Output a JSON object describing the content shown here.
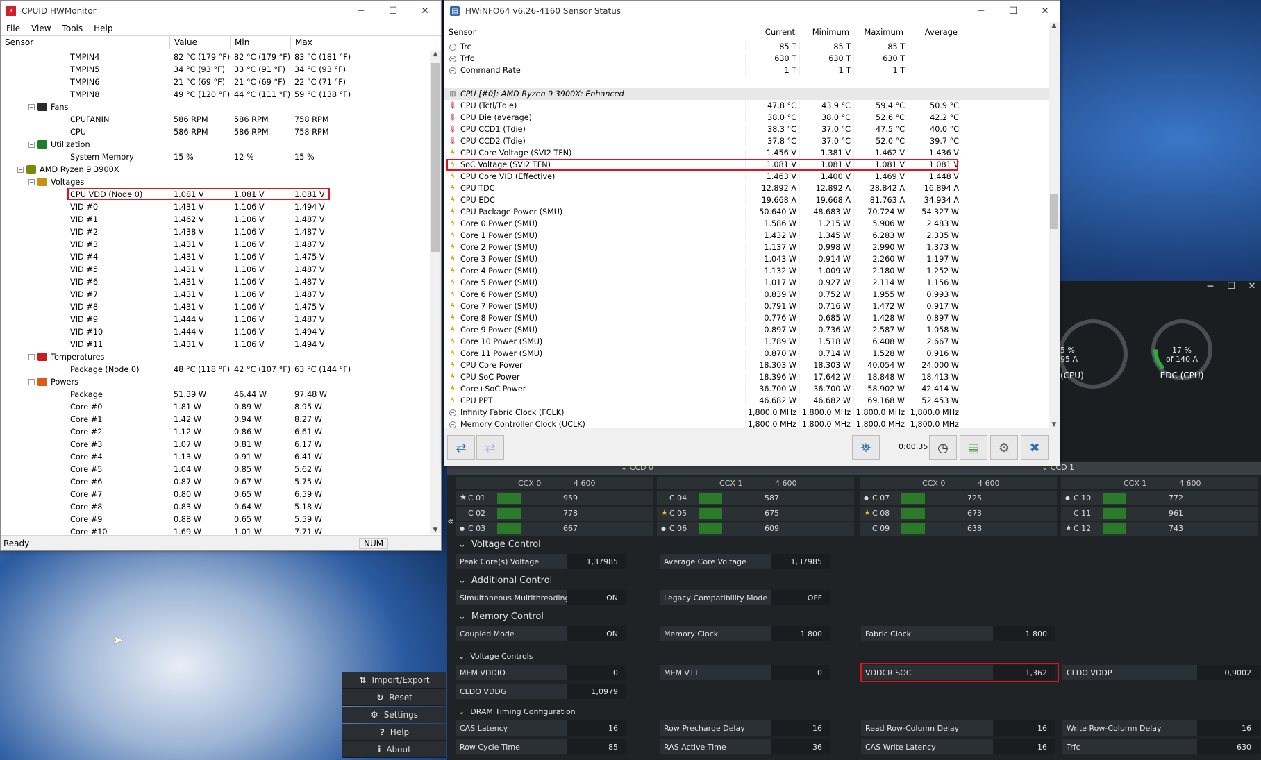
{
  "hwm": {
    "title": "CPUID HWMonitor",
    "menu": [
      "File",
      "View",
      "Tools",
      "Help"
    ],
    "cols": [
      "Sensor",
      "Value",
      "Min",
      "Max"
    ],
    "rows": [
      {
        "i": 4,
        "n": "TMPIN4",
        "v": "82 °C  (179 °F)",
        "mi": "82 °C  (179 °F)",
        "ma": "83 °C  (181 °F)"
      },
      {
        "i": 4,
        "n": "TMPIN5",
        "v": "34 °C  (93 °F)",
        "mi": "33 °C  (91 °F)",
        "ma": "34 °C  (93 °F)"
      },
      {
        "i": 4,
        "n": "TMPIN6",
        "v": "21 °C  (69 °F)",
        "mi": "21 °C  (69 °F)",
        "ma": "22 °C  (71 °F)"
      },
      {
        "i": 4,
        "n": "TMPIN8",
        "v": "49 °C  (120 °F)",
        "mi": "44 °C  (111 °F)",
        "ma": "59 °C  (138 °F)"
      },
      {
        "i": 2,
        "g": "fan",
        "n": "Fans"
      },
      {
        "i": 4,
        "n": "CPUFANIN",
        "v": "586 RPM",
        "mi": "586 RPM",
        "ma": "758 RPM"
      },
      {
        "i": 4,
        "n": "CPU",
        "v": "586 RPM",
        "mi": "586 RPM",
        "ma": "758 RPM"
      },
      {
        "i": 2,
        "g": "util",
        "n": "Utilization"
      },
      {
        "i": 4,
        "n": "System Memory",
        "v": "15 %",
        "mi": "12 %",
        "ma": "15 %"
      },
      {
        "i": 1,
        "g": "chip",
        "n": "AMD Ryzen 9 3900X"
      },
      {
        "i": 2,
        "g": "volt",
        "n": "Voltages"
      },
      {
        "i": 4,
        "n": "CPU VDD (Node 0)",
        "v": "1.081 V",
        "mi": "1.081 V",
        "ma": "1.081 V",
        "hl": true
      },
      {
        "i": 4,
        "n": "VID #0",
        "v": "1.431 V",
        "mi": "1.106 V",
        "ma": "1.494 V"
      },
      {
        "i": 4,
        "n": "VID #1",
        "v": "1.462 V",
        "mi": "1.106 V",
        "ma": "1.487 V"
      },
      {
        "i": 4,
        "n": "VID #2",
        "v": "1.438 V",
        "mi": "1.106 V",
        "ma": "1.487 V"
      },
      {
        "i": 4,
        "n": "VID #3",
        "v": "1.431 V",
        "mi": "1.106 V",
        "ma": "1.487 V"
      },
      {
        "i": 4,
        "n": "VID #4",
        "v": "1.431 V",
        "mi": "1.106 V",
        "ma": "1.475 V"
      },
      {
        "i": 4,
        "n": "VID #5",
        "v": "1.431 V",
        "mi": "1.106 V",
        "ma": "1.487 V"
      },
      {
        "i": 4,
        "n": "VID #6",
        "v": "1.431 V",
        "mi": "1.106 V",
        "ma": "1.487 V"
      },
      {
        "i": 4,
        "n": "VID #7",
        "v": "1.431 V",
        "mi": "1.106 V",
        "ma": "1.487 V"
      },
      {
        "i": 4,
        "n": "VID #8",
        "v": "1.431 V",
        "mi": "1.106 V",
        "ma": "1.475 V"
      },
      {
        "i": 4,
        "n": "VID #9",
        "v": "1.444 V",
        "mi": "1.106 V",
        "ma": "1.487 V"
      },
      {
        "i": 4,
        "n": "VID #10",
        "v": "1.444 V",
        "mi": "1.106 V",
        "ma": "1.494 V"
      },
      {
        "i": 4,
        "n": "VID #11",
        "v": "1.431 V",
        "mi": "1.106 V",
        "ma": "1.494 V"
      },
      {
        "i": 2,
        "g": "temp",
        "n": "Temperatures"
      },
      {
        "i": 4,
        "n": "Package (Node 0)",
        "v": "48 °C  (118 °F)",
        "mi": "42 °C  (107 °F)",
        "ma": "63 °C  (144 °F)"
      },
      {
        "i": 2,
        "g": "pow",
        "n": "Powers"
      },
      {
        "i": 4,
        "n": "Package",
        "v": "51.39 W",
        "mi": "46.44 W",
        "ma": "97.48 W"
      },
      {
        "i": 4,
        "n": "Core #0",
        "v": "1.81 W",
        "mi": "0.89 W",
        "ma": "8.95 W"
      },
      {
        "i": 4,
        "n": "Core #1",
        "v": "1.42 W",
        "mi": "0.94 W",
        "ma": "8.27 W"
      },
      {
        "i": 4,
        "n": "Core #2",
        "v": "1.12 W",
        "mi": "0.86 W",
        "ma": "6.61 W"
      },
      {
        "i": 4,
        "n": "Core #3",
        "v": "1.07 W",
        "mi": "0.81 W",
        "ma": "6.17 W"
      },
      {
        "i": 4,
        "n": "Core #4",
        "v": "1.13 W",
        "mi": "0.91 W",
        "ma": "6.41 W"
      },
      {
        "i": 4,
        "n": "Core #5",
        "v": "1.04 W",
        "mi": "0.85 W",
        "ma": "5.62 W"
      },
      {
        "i": 4,
        "n": "Core #6",
        "v": "0.87 W",
        "mi": "0.67 W",
        "ma": "5.75 W"
      },
      {
        "i": 4,
        "n": "Core #7",
        "v": "0.80 W",
        "mi": "0.65 W",
        "ma": "6.59 W"
      },
      {
        "i": 4,
        "n": "Core #8",
        "v": "0.83 W",
        "mi": "0.64 W",
        "ma": "5.18 W"
      },
      {
        "i": 4,
        "n": "Core #9",
        "v": "0.88 W",
        "mi": "0.65 W",
        "ma": "5.59 W"
      },
      {
        "i": 4,
        "n": "Core #10",
        "v": "1.69 W",
        "mi": "1.01 W",
        "ma": "7.71 W"
      }
    ],
    "status": "Ready",
    "num": "NUM"
  },
  "hwi": {
    "title": "HWiNFO64 v6.26-4160 Sensor Status",
    "cols": [
      "Sensor",
      "Current",
      "Minimum",
      "Maximum",
      "Average"
    ],
    "rows": [
      {
        "ic": "clk",
        "n": "Trc",
        "c": "85 T",
        "mi": "85 T",
        "ma": "85 T",
        "a": ""
      },
      {
        "ic": "clk",
        "n": "Trfc",
        "c": "630 T",
        "mi": "630 T",
        "ma": "630 T",
        "a": ""
      },
      {
        "ic": "clk",
        "n": "Command Rate",
        "c": "1 T",
        "mi": "1 T",
        "ma": "1 T",
        "a": ""
      },
      {
        "ic": "",
        "n": "",
        "c": "",
        "mi": "",
        "ma": "",
        "a": ""
      },
      {
        "ic": "grp",
        "n": "CPU [#0]: AMD Ryzen 9 3900X: Enhanced",
        "c": "",
        "mi": "",
        "ma": "",
        "a": "",
        "grp": true
      },
      {
        "ic": "temp",
        "n": "CPU (Tctl/Tdie)",
        "c": "47.8 °C",
        "mi": "43.9 °C",
        "ma": "59.4 °C",
        "a": "50.9 °C"
      },
      {
        "ic": "temp",
        "n": "CPU Die (average)",
        "c": "38.0 °C",
        "mi": "38.0 °C",
        "ma": "52.6 °C",
        "a": "42.2 °C"
      },
      {
        "ic": "temp",
        "n": "CPU CCD1 (Tdie)",
        "c": "38.3 °C",
        "mi": "37.0 °C",
        "ma": "47.5 °C",
        "a": "40.0 °C"
      },
      {
        "ic": "temp",
        "n": "CPU CCD2 (Tdie)",
        "c": "37.8 °C",
        "mi": "37.0 °C",
        "ma": "52.0 °C",
        "a": "39.7 °C"
      },
      {
        "ic": "bolt",
        "n": "CPU Core Voltage (SVI2 TFN)",
        "c": "1.456 V",
        "mi": "1.381 V",
        "ma": "1.462 V",
        "a": "1.436 V"
      },
      {
        "ic": "bolt",
        "n": "SoC Voltage (SVI2 TFN)",
        "c": "1.081 V",
        "mi": "1.081 V",
        "ma": "1.081 V",
        "a": "1.081 V",
        "hl": true
      },
      {
        "ic": "bolt",
        "n": "CPU Core VID (Effective)",
        "c": "1.463 V",
        "mi": "1.400 V",
        "ma": "1.469 V",
        "a": "1.448 V"
      },
      {
        "ic": "bolt",
        "n": "CPU TDC",
        "c": "12.892 A",
        "mi": "12.892 A",
        "ma": "28.842 A",
        "a": "16.894 A"
      },
      {
        "ic": "bolt",
        "n": "CPU EDC",
        "c": "19.668 A",
        "mi": "19.668 A",
        "ma": "81.763 A",
        "a": "34.934 A"
      },
      {
        "ic": "bolt",
        "n": "CPU Package Power (SMU)",
        "c": "50.640 W",
        "mi": "48.683 W",
        "ma": "70.724 W",
        "a": "54.327 W"
      },
      {
        "ic": "bolt",
        "n": "Core 0 Power (SMU)",
        "c": "1.586 W",
        "mi": "1.215 W",
        "ma": "5.906 W",
        "a": "2.483 W"
      },
      {
        "ic": "bolt",
        "n": "Core 1 Power (SMU)",
        "c": "1.432 W",
        "mi": "1.345 W",
        "ma": "6.283 W",
        "a": "2.335 W"
      },
      {
        "ic": "bolt",
        "n": "Core 2 Power (SMU)",
        "c": "1.137 W",
        "mi": "0.998 W",
        "ma": "2.990 W",
        "a": "1.373 W"
      },
      {
        "ic": "bolt",
        "n": "Core 3 Power (SMU)",
        "c": "1.043 W",
        "mi": "0.914 W",
        "ma": "2.260 W",
        "a": "1.197 W"
      },
      {
        "ic": "bolt",
        "n": "Core 4 Power (SMU)",
        "c": "1.132 W",
        "mi": "1.009 W",
        "ma": "2.180 W",
        "a": "1.252 W"
      },
      {
        "ic": "bolt",
        "n": "Core 5 Power (SMU)",
        "c": "1.017 W",
        "mi": "0.927 W",
        "ma": "2.114 W",
        "a": "1.156 W"
      },
      {
        "ic": "bolt",
        "n": "Core 6 Power (SMU)",
        "c": "0.839 W",
        "mi": "0.752 W",
        "ma": "1.955 W",
        "a": "0.993 W"
      },
      {
        "ic": "bolt",
        "n": "Core 7 Power (SMU)",
        "c": "0.791 W",
        "mi": "0.716 W",
        "ma": "1.472 W",
        "a": "0.917 W"
      },
      {
        "ic": "bolt",
        "n": "Core 8 Power (SMU)",
        "c": "0.776 W",
        "mi": "0.685 W",
        "ma": "1.428 W",
        "a": "0.897 W"
      },
      {
        "ic": "bolt",
        "n": "Core 9 Power (SMU)",
        "c": "0.897 W",
        "mi": "0.736 W",
        "ma": "2.587 W",
        "a": "1.058 W"
      },
      {
        "ic": "bolt",
        "n": "Core 10 Power (SMU)",
        "c": "1.789 W",
        "mi": "1.518 W",
        "ma": "6.408 W",
        "a": "2.667 W"
      },
      {
        "ic": "bolt",
        "n": "Core 11 Power (SMU)",
        "c": "0.870 W",
        "mi": "0.714 W",
        "ma": "1.528 W",
        "a": "0.916 W"
      },
      {
        "ic": "bolt",
        "n": "CPU Core Power",
        "c": "18.303 W",
        "mi": "18.303 W",
        "ma": "40.054 W",
        "a": "24.000 W"
      },
      {
        "ic": "bolt",
        "n": "CPU SoC Power",
        "c": "18.396 W",
        "mi": "17.642 W",
        "ma": "18.848 W",
        "a": "18.413 W"
      },
      {
        "ic": "bolt",
        "n": "Core+SoC Power",
        "c": "36.700 W",
        "mi": "36.700 W",
        "ma": "58.902 W",
        "a": "42.414 W"
      },
      {
        "ic": "bolt",
        "n": "CPU PPT",
        "c": "46.682 W",
        "mi": "46.682 W",
        "ma": "69.168 W",
        "a": "52.453 W"
      },
      {
        "ic": "clk",
        "n": "Infinity Fabric Clock (FCLK)",
        "c": "1,800.0 MHz",
        "mi": "1,800.0 MHz",
        "ma": "1,800.0 MHz",
        "a": "1,800.0 MHz"
      },
      {
        "ic": "clk",
        "n": "Memory Controller Clock (UCLK)",
        "c": "1,800.0 MHz",
        "mi": "1,800.0 MHz",
        "ma": "1,800.0 MHz",
        "a": "1,800.0 MHz"
      }
    ],
    "timer": "0:00:35"
  },
  "rm": {
    "gauges": [
      {
        "pct": "5 %",
        "of": "95 A",
        "label": "(CPU)"
      },
      {
        "pct": "17 %",
        "of": "of 140 A",
        "label": "EDC (CPU)",
        "fill": 0.17
      }
    ],
    "ccd0": "CCD 0",
    "ccd1": "CCD 1",
    "ccx": [
      {
        "name": "CCX 0",
        "freq": "4 600"
      },
      {
        "name": "CCX 1",
        "freq": "4 600"
      },
      {
        "name": "CCX 0",
        "freq": "4 600"
      },
      {
        "name": "CCX 1",
        "freq": "4 600"
      }
    ],
    "cores": [
      [
        {
          "m": "star",
          "n": "C 01",
          "v": "959"
        },
        {
          "m": "",
          "n": "C 02",
          "v": "778"
        },
        {
          "m": "dot",
          "n": "C 03",
          "v": "667"
        }
      ],
      [
        {
          "m": "",
          "n": "C 04",
          "v": "587"
        },
        {
          "m": "gstar",
          "n": "C 05",
          "v": "675"
        },
        {
          "m": "dot",
          "n": "C 06",
          "v": "609"
        }
      ],
      [
        {
          "m": "dot",
          "n": "C 07",
          "v": "725"
        },
        {
          "m": "gstar",
          "n": "C 08",
          "v": "673"
        },
        {
          "m": "",
          "n": "C 09",
          "v": "638"
        }
      ],
      [
        {
          "m": "dot",
          "n": "C 10",
          "v": "772"
        },
        {
          "m": "",
          "n": "C 11",
          "v": "961"
        },
        {
          "m": "star",
          "n": "C 12",
          "v": "743"
        }
      ]
    ],
    "sections": {
      "vc": "Voltage Control",
      "ac": "Additional Control",
      "mc": "Memory Control",
      "vcs": "Voltage Controls",
      "dram": "DRAM Timing Configuration"
    },
    "peak": {
      "l": "Peak Core(s) Voltage",
      "v": "1,37985"
    },
    "avg": {
      "l": "Average Core Voltage",
      "v": "1,37985"
    },
    "smt": {
      "l": "Simultaneous Multithreading",
      "v": "ON"
    },
    "legacy": {
      "l": "Legacy Compatibility Mode",
      "v": "OFF"
    },
    "coupled": {
      "l": "Coupled Mode",
      "v": "ON"
    },
    "memclk": {
      "l": "Memory Clock",
      "v": "1 800"
    },
    "fabclk": {
      "l": "Fabric Clock",
      "v": "1 800"
    },
    "vddio": {
      "l": "MEM VDDIO",
      "v": "0"
    },
    "vtt": {
      "l": "MEM VTT",
      "v": "0"
    },
    "vddcr": {
      "l": "VDDCR SOC",
      "v": "1,362"
    },
    "vddp": {
      "l": "CLDO VDDP",
      "v": "0,9002"
    },
    "vddg": {
      "l": "CLDO VDDG",
      "v": "1,0979"
    },
    "cas": {
      "l": "CAS Latency",
      "v": "16"
    },
    "rp": {
      "l": "Row Precharge Delay",
      "v": "16"
    },
    "rcdr": {
      "l": "Read Row-Column Delay",
      "v": "16"
    },
    "rcdw": {
      "l": "Write Row-Column Delay",
      "v": "16"
    },
    "rc": {
      "l": "Row Cycle Time",
      "v": "85"
    },
    "ras": {
      "l": "RAS Active Time",
      "v": "36"
    },
    "cwl": {
      "l": "CAS Write Latency",
      "v": "16"
    },
    "trfc": {
      "l": "Trfc",
      "v": "630"
    },
    "menu": [
      "Import/Export",
      "Reset",
      "Settings",
      "Help",
      "About"
    ]
  }
}
